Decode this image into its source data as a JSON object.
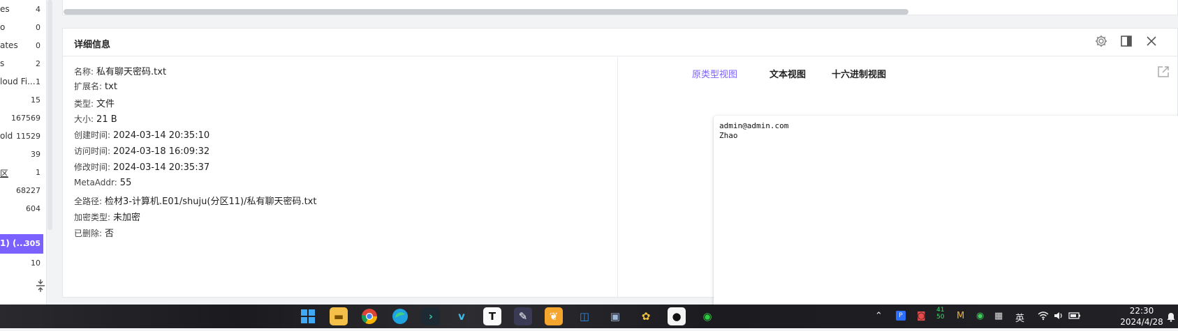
{
  "sidebar": {
    "items": [
      {
        "label": "es",
        "count": "4"
      },
      {
        "label": "o",
        "count": "0"
      },
      {
        "label": "ates",
        "count": "0"
      },
      {
        "label": "s",
        "count": "2"
      },
      {
        "label": "loud Fi...",
        "count": "1"
      },
      {
        "label": "",
        "count": "15"
      },
      {
        "label": "",
        "count": "167569"
      },
      {
        "label": "old",
        "count": "11529"
      },
      {
        "label": "",
        "count": "39"
      },
      {
        "label": "区",
        "count": "1"
      },
      {
        "label": "",
        "count": "68227"
      },
      {
        "label": "",
        "count": "604"
      },
      {
        "label": "1)  (...",
        "count": "305"
      },
      {
        "label": "",
        "count": "10"
      }
    ],
    "collapse_icon": "collapse-vertical-icon"
  },
  "detail": {
    "title": "详细信息",
    "icons": [
      "gear-icon",
      "split-panel-icon",
      "close-icon"
    ],
    "props": [
      {
        "key": "名称:",
        "value": "私有聊天密码.txt"
      },
      {
        "key": "扩展名:",
        "value": "txt"
      },
      {
        "key": "类型:",
        "value": "文件"
      },
      {
        "key": "大小:",
        "value": "21 B"
      },
      {
        "key": "创建时间:",
        "value": "2024-03-14 20:35:10"
      },
      {
        "key": "访问时间:",
        "value": "2024-03-18 16:09:32"
      },
      {
        "key": "修改时间:",
        "value": "2024-03-14 20:35:37"
      },
      {
        "key": "MetaAddr:",
        "value": "55"
      },
      {
        "key": "全路径:",
        "value": "检材3-计算机.E01/shuju(分区11)/私有聊天密码.txt"
      },
      {
        "key": "加密类型:",
        "value": "未加密"
      },
      {
        "key": "已删除:",
        "value": "否"
      }
    ]
  },
  "viewer": {
    "tabs": [
      "原类型视图",
      "文本视图",
      "十六进制视图"
    ],
    "active_tab": 0,
    "popout_icon": "external-link-icon",
    "content_lines": [
      "admin@admin.com",
      "Zhao"
    ]
  },
  "taskbar": {
    "icons": [
      "windows-start-icon",
      "file-explorer-icon",
      "chrome-icon",
      "edge-icon",
      "terminal-icon",
      "vk-icon",
      "typora-icon",
      "feather-icon",
      "leaf-icon",
      "box-icon",
      "monitor-icon",
      "paw-icon",
      "qq-icon",
      "wechat-icon"
    ],
    "tray": {
      "ime": "英",
      "time": "22:30",
      "date": "2024/4/28",
      "cpu": "41\n50"
    }
  },
  "colors": {
    "accent": "#7b61ff",
    "taskbar": "#1f1f23"
  }
}
